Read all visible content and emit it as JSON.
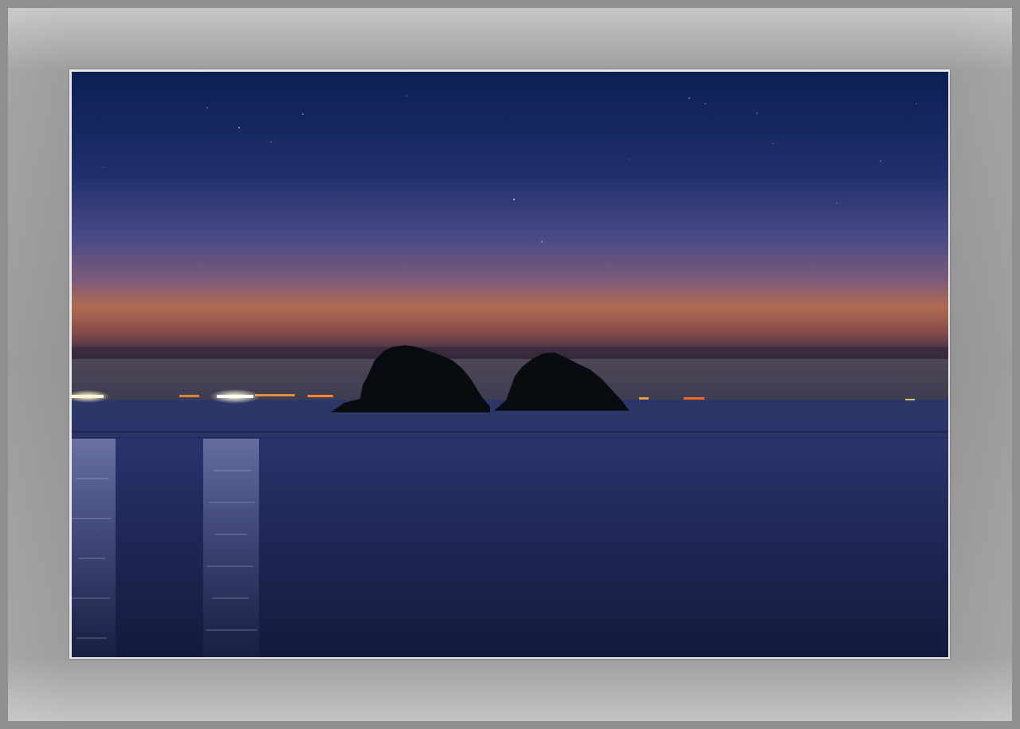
{
  "image": {
    "subject": "",
    "colors": {
      "frame_outer": "#8f8f8f",
      "mat": "#9a9a9a",
      "sky_top": "#0b1e4e",
      "sky_mid": "#3a3f7a",
      "horizon_glow": "#b0694a",
      "haze": "#2a2540",
      "sea": "#1c2550",
      "island": "#0a0d12"
    }
  }
}
